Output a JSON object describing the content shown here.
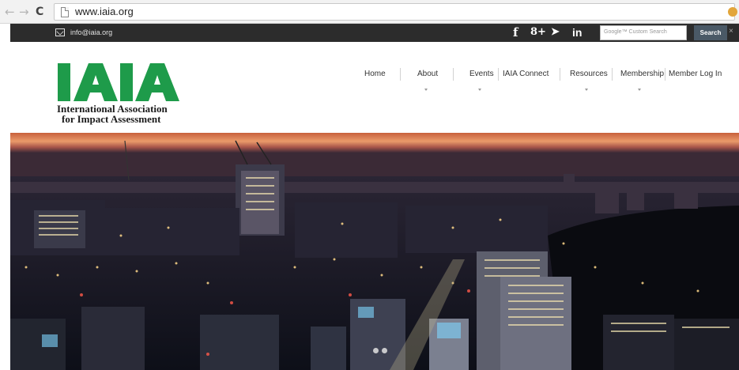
{
  "browser": {
    "back_icon": "←",
    "forward_icon": "→",
    "reload_icon": "C",
    "url": "www.iaia.org"
  },
  "topbar": {
    "email": "info@iaia.org",
    "social": {
      "facebook": "f",
      "googleplus": "8+",
      "twitter": "➤",
      "linkedin": "in"
    },
    "search_placeholder": "Google™ Custom Search",
    "search_button": "Search",
    "close": "×"
  },
  "logo": {
    "mark": "IAIA",
    "line1": "International Association",
    "line2": "for Impact Assessment",
    "color": "#1e9b4a"
  },
  "menu": {
    "items": [
      {
        "label": "Home"
      },
      {
        "label": "About"
      },
      {
        "label": "Events"
      },
      {
        "label": "IAIA Connect"
      },
      {
        "label": "Resources"
      },
      {
        "label": "Membership"
      },
      {
        "label": "Member Log In"
      }
    ]
  },
  "hero": {
    "slides": 2,
    "active_slide": 1
  }
}
